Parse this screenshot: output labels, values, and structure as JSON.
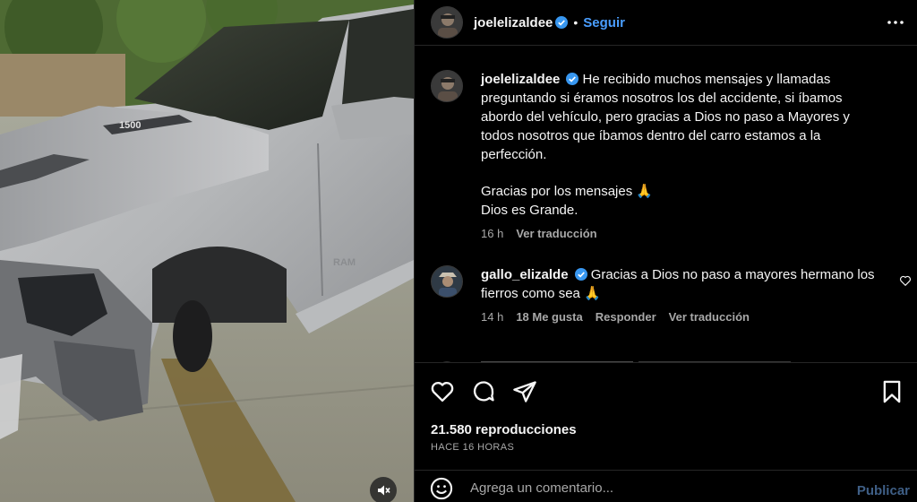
{
  "post": {
    "author": "joelelizaldee",
    "follow_label": "Seguir",
    "separator": "•"
  },
  "caption": {
    "author": "joelelizaldee",
    "text_line1": "He recibido muchos mensajes y llamadas preguntando si éramos nosotros los del accidente, si íbamos abordo del vehículo, pero gracias a Dios no paso a Mayores y todos nosotros que íbamos dentro del carro estamos a la perfección.",
    "text_line2": "Gracias por los mensajes 🙏",
    "text_line3": "Dios es Grande.",
    "time": "16 h",
    "translate": "Ver traducción"
  },
  "comment": {
    "author": "gallo_elizalde",
    "text": "Gracias a Dios no paso a mayores hermano los fierros como sea 🙏",
    "time": "14 h",
    "likes": "18 Me gusta",
    "reply": "Responder",
    "translate": "Ver traducción"
  },
  "stats": {
    "views": "21.580 reproducciones",
    "ago": "HACE 16 HORAS"
  },
  "composer": {
    "placeholder": "Agrega un comentario...",
    "publish": "Publicar"
  },
  "media": {
    "truck_badge": "1500",
    "door_badge": "RAM"
  },
  "colors": {
    "accent": "#4a9eff",
    "verified": "#3897f0",
    "secondary_text": "#a8a8a8",
    "divider": "#262626"
  },
  "icons": [
    "verified-badge-icon",
    "more-options-icon",
    "heart-icon",
    "comment-icon",
    "share-icon",
    "bookmark-icon",
    "emoji-icon",
    "mute-icon"
  ]
}
